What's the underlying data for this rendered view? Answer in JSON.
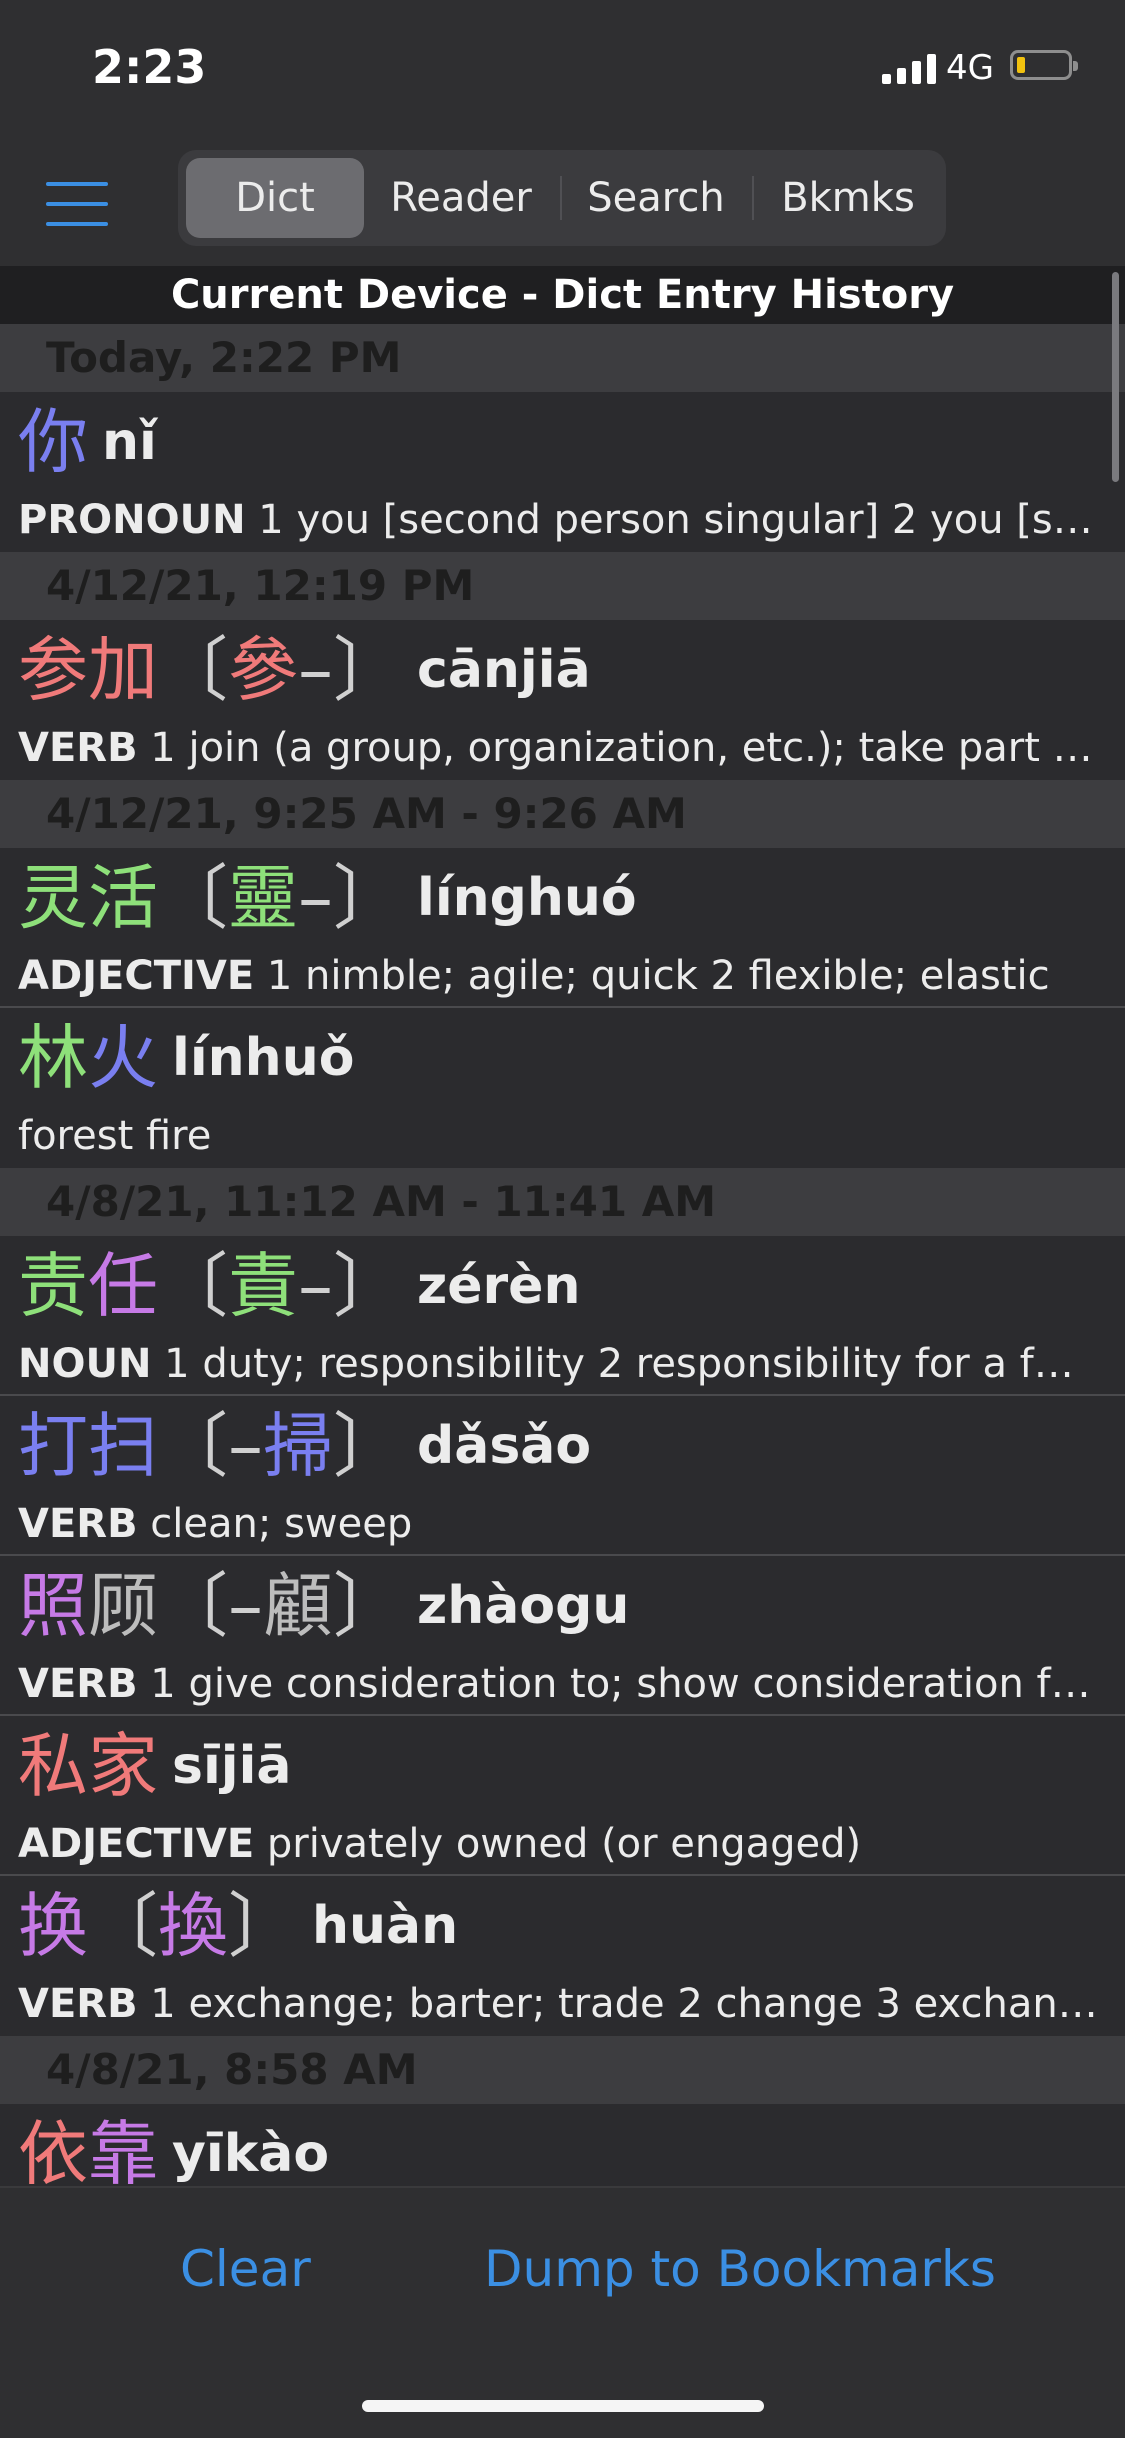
{
  "status": {
    "time": "2:23",
    "network": "4G"
  },
  "tabs": [
    "Dict",
    "Reader",
    "Search",
    "Bkmks"
  ],
  "active_tab": "Dict",
  "list_title": "Current Device - Dict Entry History",
  "sections": [
    {
      "header": "Today, 2:22 PM",
      "entries": [
        {
          "chars": [
            {
              "t": "你",
              "c": "#7a7ff0"
            }
          ],
          "trad": [],
          "pinyin": "nǐ",
          "pos": "PRONOUN",
          "def": " 1 you [second person singular]  2 you [s…"
        }
      ]
    },
    {
      "header": "4/12/21, 12:19 PM",
      "entries": [
        {
          "chars": [
            {
              "t": "参",
              "c": "#f07a7a"
            },
            {
              "t": "加",
              "c": "#f07a7a"
            }
          ],
          "trad": [
            {
              "t": "參",
              "c": "#f07a7a"
            },
            {
              "t": "–",
              "c": "#d0d0d0"
            }
          ],
          "pinyin": "cānjiā",
          "pos": "VERB",
          "def": " 1 join (a group, organization, etc.); take part i…"
        }
      ]
    },
    {
      "header": "4/12/21, 9:25 AM - 9:26 AM",
      "entries": [
        {
          "chars": [
            {
              "t": "灵",
              "c": "#8ee07a"
            },
            {
              "t": "活",
              "c": "#8ee07a"
            }
          ],
          "trad": [
            {
              "t": "靈",
              "c": "#8ee07a"
            },
            {
              "t": "–",
              "c": "#d0d0d0"
            }
          ],
          "pinyin": "línghuó",
          "pos": "ADJECTIVE",
          "def": " 1 nimble; agile; quick  2 flexible; elastic"
        },
        {
          "chars": [
            {
              "t": "林",
              "c": "#8ee07a"
            },
            {
              "t": "火",
              "c": "#7a7ff0"
            }
          ],
          "trad": [],
          "pinyin": "línhuǒ",
          "pos": "",
          "def": "forest fire"
        }
      ]
    },
    {
      "header": "4/8/21, 11:12 AM - 11:41 AM",
      "entries": [
        {
          "chars": [
            {
              "t": "责",
              "c": "#8ee07a"
            },
            {
              "t": "任",
              "c": "#c67ae6"
            }
          ],
          "trad": [
            {
              "t": "責",
              "c": "#8ee07a"
            },
            {
              "t": "–",
              "c": "#d0d0d0"
            }
          ],
          "pinyin": "zérèn",
          "pos": "NOUN",
          "def": " 1 duty; responsibility  2 responsibility for a fa…"
        },
        {
          "chars": [
            {
              "t": "打",
              "c": "#7a7ff0"
            },
            {
              "t": "扫",
              "c": "#7a7ff0"
            }
          ],
          "trad": [
            {
              "t": "–",
              "c": "#d0d0d0"
            },
            {
              "t": "掃",
              "c": "#7a7ff0"
            }
          ],
          "pinyin": "dǎsǎo",
          "pos": "VERB",
          "def": " clean; sweep"
        },
        {
          "chars": [
            {
              "t": "照",
              "c": "#c67ae6"
            },
            {
              "t": "顾",
              "c": "#bdbdbd"
            }
          ],
          "trad": [
            {
              "t": "–",
              "c": "#d0d0d0"
            },
            {
              "t": "顧",
              "c": "#bdbdbd"
            }
          ],
          "pinyin": "zhàogu",
          "pos": "VERB",
          "def": " 1 give consideration to; show consideration f…"
        },
        {
          "chars": [
            {
              "t": "私",
              "c": "#f07a7a"
            },
            {
              "t": "家",
              "c": "#f07a7a"
            }
          ],
          "trad": [],
          "pinyin": "sījiā",
          "pos": "ADJECTIVE",
          "def": " privately owned (or engaged)"
        },
        {
          "chars": [
            {
              "t": "换",
              "c": "#c67ae6"
            }
          ],
          "trad": [
            {
              "t": "換",
              "c": "#c67ae6"
            }
          ],
          "pinyin": "huàn",
          "pos": "VERB",
          "def": " 1 exchange; barter; trade  2 change  3 exchan…"
        }
      ]
    },
    {
      "header": "4/8/21, 8:58 AM",
      "entries": [
        {
          "chars": [
            {
              "t": "依",
              "c": "#f07a7a"
            },
            {
              "t": "靠",
              "c": "#c67ae6"
            }
          ],
          "trad": [],
          "pinyin": "yīkào",
          "pos": "",
          "def": ""
        }
      ]
    }
  ],
  "buttons": {
    "clear": "Clear",
    "dump": "Dump to Bookmarks"
  },
  "colors": {
    "accent": "#3b8fe3",
    "tone1": "#f07a7a",
    "tone2": "#8ee07a",
    "tone3": "#7a7ff0",
    "tone4": "#c67ae6",
    "neutral": "#bdbdbd"
  }
}
